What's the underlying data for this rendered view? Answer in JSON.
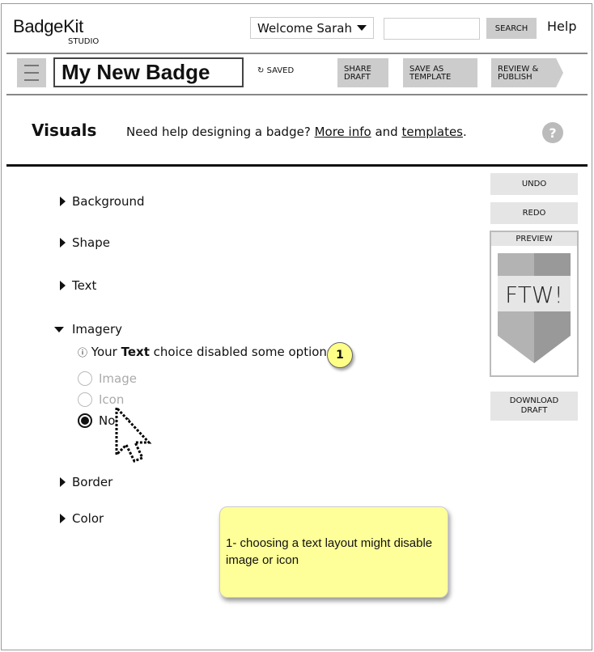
{
  "header": {
    "logo": "BadgeKit",
    "logo_sub": "STUDIO",
    "welcome": "Welcome Sarah",
    "search_value": "",
    "search_label": "SEARCH",
    "help": "Help"
  },
  "toolbar": {
    "badge_title": "My New Badge",
    "saved": "SAVED",
    "share": [
      "SHARE",
      "DRAFT"
    ],
    "template": [
      "SAVE AS",
      "TEMPLATE"
    ],
    "publish": [
      "REVIEW &",
      "PUBLISH"
    ]
  },
  "visuals": {
    "heading": "Visuals",
    "help_prefix": "Need help designing a badge?",
    "more_info": "More info",
    "and": "and",
    "templates": "templates",
    "period": ".",
    "help_icon": "?"
  },
  "sections": {
    "background": "Background",
    "shape": "Shape",
    "text": "Text",
    "imagery": "Imagery",
    "border": "Border",
    "color": "Color"
  },
  "imagery": {
    "info_prefix": "Your",
    "info_bold": "Text",
    "info_suffix": "choice disabled some options",
    "options": [
      {
        "label": "Image",
        "disabled": true,
        "selected": false
      },
      {
        "label": "Icon",
        "disabled": true,
        "selected": false
      },
      {
        "label": "None",
        "disabled": false,
        "selected": true
      }
    ]
  },
  "side": {
    "undo": "UNDO",
    "redo": "REDO",
    "preview": "PREVIEW",
    "badge_text": "FTW!",
    "download": [
      "DOWNLOAD",
      "DRAFT"
    ]
  },
  "annotation": {
    "marker": "1",
    "note": "1- choosing a text layout might disable image or icon"
  },
  "colors": {
    "button_gray": "#cccccc",
    "light_gray": "#e5e5e5",
    "sticky": "#ffff99"
  }
}
